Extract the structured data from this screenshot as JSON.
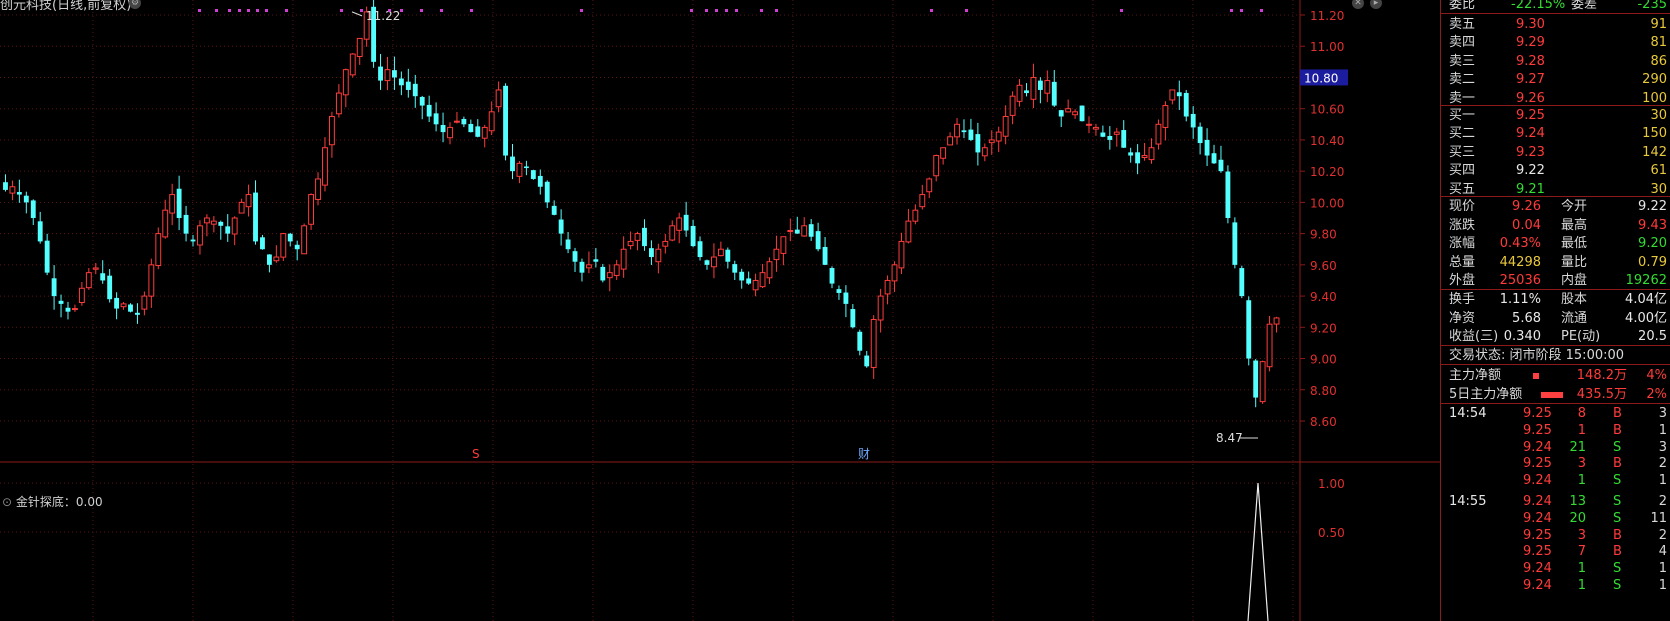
{
  "header": {
    "title": "创元科技(日线,前复权)"
  },
  "indicator": {
    "label": "金针探底",
    "value": "0.00"
  },
  "price_tag": "10.80",
  "markers": {
    "s": "S",
    "cai": "财"
  },
  "annotations": {
    "high": "11.22",
    "low": "8.47"
  },
  "chart_data": {
    "type": "candlestick",
    "title": "创元科技(日线,前复权)",
    "ylim": [
      8.45,
      11.25
    ],
    "y_ticks": [
      "11.20",
      "11.00",
      "10.80",
      "10.60",
      "10.40",
      "10.20",
      "10.00",
      "9.80",
      "9.60",
      "9.40",
      "9.20",
      "9.00",
      "8.80",
      "8.60"
    ],
    "sub_y_ticks": [
      "1.00",
      "0.50"
    ],
    "high_annotation": 11.22,
    "low_annotation": 8.47,
    "closes": [
      10.08,
      10.1,
      10.05,
      10.0,
      9.9,
      9.75,
      9.55,
      9.4,
      9.35,
      9.3,
      9.32,
      9.45,
      9.55,
      9.58,
      9.5,
      9.38,
      9.32,
      9.35,
      9.3,
      9.28,
      9.4,
      9.6,
      9.8,
      9.95,
      10.05,
      9.9,
      9.8,
      9.75,
      9.85,
      9.9,
      9.88,
      9.85,
      9.8,
      9.9,
      10.0,
      10.05,
      9.75,
      9.7,
      9.6,
      9.65,
      9.8,
      9.75,
      9.7,
      9.85,
      10.05,
      10.15,
      10.35,
      10.55,
      10.7,
      10.85,
      10.95,
      11.05,
      11.22,
      10.9,
      10.78,
      10.85,
      10.8,
      10.75,
      10.72,
      10.68,
      10.62,
      10.55,
      10.5,
      10.45,
      10.48,
      10.52,
      10.5,
      10.45,
      10.42,
      10.48,
      10.58,
      10.72,
      10.3,
      10.2,
      10.25,
      10.22,
      10.15,
      10.1,
      10.0,
      9.92,
      9.8,
      9.7,
      9.62,
      9.55,
      9.6,
      9.62,
      9.5,
      9.55,
      9.6,
      9.7,
      9.75,
      9.8,
      9.72,
      9.65,
      9.7,
      9.75,
      9.85,
      9.9,
      9.82,
      9.72,
      9.65,
      9.6,
      9.65,
      9.7,
      9.62,
      9.55,
      9.5,
      9.48,
      9.5,
      9.55,
      9.62,
      9.7,
      9.78,
      9.82,
      9.8,
      9.85,
      9.78,
      9.7,
      9.6,
      9.48,
      9.42,
      9.35,
      9.2,
      9.05,
      8.95,
      9.25,
      9.4,
      9.5,
      9.6,
      9.75,
      9.88,
      9.95,
      10.05,
      10.15,
      10.3,
      10.35,
      10.42,
      10.5,
      10.45,
      10.4,
      10.32,
      10.35,
      10.4,
      10.45,
      10.55,
      10.68,
      10.75,
      10.7,
      10.8,
      10.72,
      10.78,
      10.62,
      10.55,
      10.6,
      10.58,
      10.52,
      10.5,
      10.48,
      10.42,
      10.4,
      10.45,
      10.35,
      10.3,
      10.25,
      10.3,
      10.35,
      10.5,
      10.62,
      10.72,
      10.68,
      10.55,
      10.48,
      10.38,
      10.3,
      10.25,
      10.2,
      9.9,
      9.6,
      9.4,
      9.0,
      8.75,
      8.98,
      9.22,
      9.26
    ]
  },
  "quote": {
    "weibi": {
      "l": "委比",
      "v": "-22.15%",
      "l2": "委差",
      "v2": "-235"
    },
    "asks": [
      {
        "l": "卖五",
        "p": "9.30",
        "q": "91"
      },
      {
        "l": "卖四",
        "p": "9.29",
        "q": "81"
      },
      {
        "l": "卖三",
        "p": "9.28",
        "q": "86"
      },
      {
        "l": "卖二",
        "p": "9.27",
        "q": "290"
      },
      {
        "l": "卖一",
        "p": "9.26",
        "q": "100"
      }
    ],
    "bids": [
      {
        "l": "买一",
        "p": "9.25",
        "q": "30"
      },
      {
        "l": "买二",
        "p": "9.24",
        "q": "150"
      },
      {
        "l": "买三",
        "p": "9.23",
        "q": "142"
      },
      {
        "l": "买四",
        "p": "9.22",
        "q": "61"
      },
      {
        "l": "买五",
        "p": "9.21",
        "q": "30"
      }
    ],
    "stats1": [
      {
        "l": "现价",
        "v": "9.26",
        "l2": "今开",
        "v2": "9.22"
      },
      {
        "l": "涨跌",
        "v": "0.04",
        "l2": "最高",
        "v2": "9.43"
      },
      {
        "l": "涨幅",
        "v": "0.43%",
        "l2": "最低",
        "v2": "9.20"
      },
      {
        "l": "总量",
        "v": "44298",
        "l2": "量比",
        "v2": "0.79"
      },
      {
        "l": "外盘",
        "v": "25036",
        "l2": "内盘",
        "v2": "19262"
      }
    ],
    "stats2": [
      {
        "l": "换手",
        "v": "1.11%",
        "l2": "股本",
        "v2": "4.04亿"
      },
      {
        "l": "净资",
        "v": "5.68",
        "l2": "流通",
        "v2": "4.00亿"
      },
      {
        "l": "收益(三)",
        "v": "0.340",
        "l2": "PE(动)",
        "v2": "20.5"
      }
    ],
    "status": "交易状态: 闭市阶段 15:00:00",
    "flow": [
      {
        "l": "主力净额",
        "v": "148.2万",
        "p": "4%"
      },
      {
        "l": "5日主力净额",
        "v": "435.5万",
        "p": "2%"
      }
    ],
    "ticks": [
      {
        "t": "14:54",
        "p": "9.25",
        "v": "8",
        "s": "B",
        "n": "3"
      },
      {
        "t": "",
        "p": "9.25",
        "v": "1",
        "s": "B",
        "n": "1"
      },
      {
        "t": "",
        "p": "9.24",
        "v": "21",
        "s": "S",
        "n": "3"
      },
      {
        "t": "",
        "p": "9.25",
        "v": "3",
        "s": "B",
        "n": "2"
      },
      {
        "t": "",
        "p": "9.24",
        "v": "1",
        "s": "S",
        "n": "1"
      },
      {
        "t": "14:55",
        "p": "9.24",
        "v": "13",
        "s": "S",
        "n": "2"
      },
      {
        "t": "",
        "p": "9.24",
        "v": "20",
        "s": "S",
        "n": "11"
      },
      {
        "t": "",
        "p": "9.25",
        "v": "3",
        "s": "B",
        "n": "2"
      },
      {
        "t": "",
        "p": "9.25",
        "v": "7",
        "s": "B",
        "n": "4"
      },
      {
        "t": "",
        "p": "9.24",
        "v": "1",
        "s": "S",
        "n": "1"
      },
      {
        "t": "",
        "p": "9.24",
        "v": "1",
        "s": "S",
        "n": "1"
      }
    ]
  }
}
